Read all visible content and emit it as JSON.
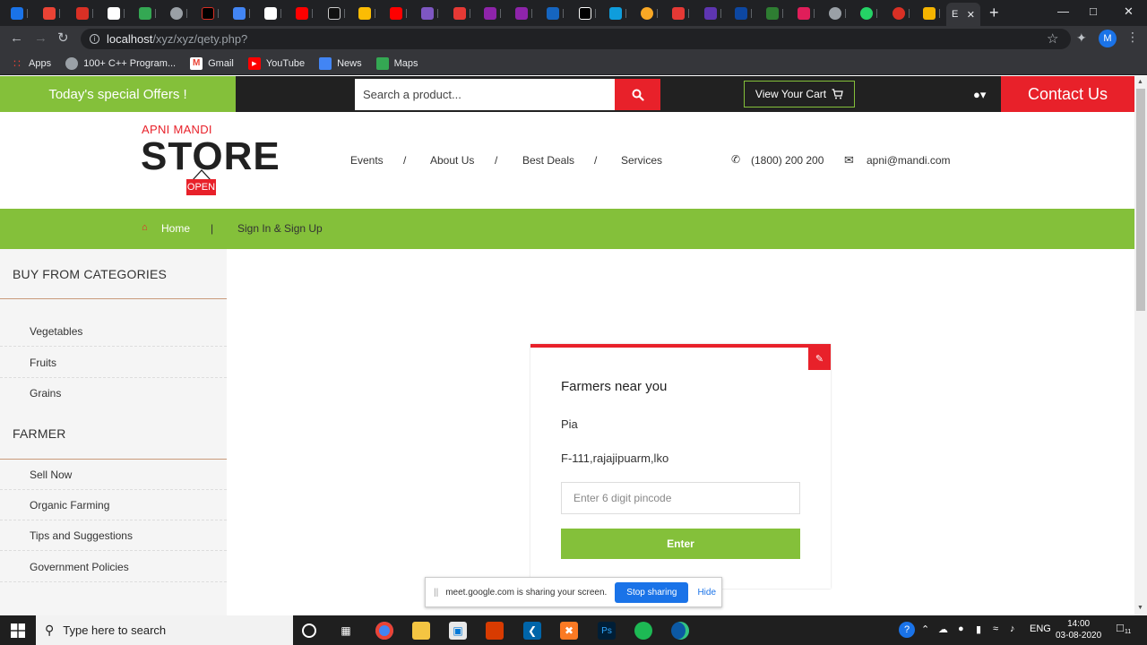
{
  "browser": {
    "url_host": "localhost",
    "url_path": "/xyz/xyz/qety.php?",
    "active_tab_label": "E",
    "profile_initial": "M",
    "bookmarks": [
      {
        "label": "Apps",
        "icon": "apps-grid-icon"
      },
      {
        "label": "100+ C++ Program...",
        "icon": "site-favicon-icon"
      },
      {
        "label": "Gmail",
        "icon": "gmail-icon"
      },
      {
        "label": "YouTube",
        "icon": "youtube-icon"
      },
      {
        "label": "News",
        "icon": "news-icon"
      },
      {
        "label": "Maps",
        "icon": "maps-icon"
      }
    ]
  },
  "topbar": {
    "offers_label": "Today's special Offers !",
    "search_placeholder": "Search a product...",
    "cart_label": "View Your Cart",
    "contact_label": "Contact Us"
  },
  "header": {
    "logo_small": "APNI MANDI",
    "logo_big": "STORE",
    "logo_sign": "OPEN",
    "nav": [
      "Events",
      "About Us",
      "Best Deals",
      "Services"
    ],
    "nav_separator": "/",
    "phone": "(1800) 200 200",
    "email": "apni@mandi.com"
  },
  "breadcrumb": {
    "home": "Home",
    "separator": "|",
    "signin": "Sign In & Sign Up"
  },
  "sidebar": {
    "categories_heading": "BUY FROM CATEGORIES",
    "categories": [
      "Vegetables",
      "Fruits",
      "Grains"
    ],
    "farmer_heading": "FARMER",
    "farmer_items": [
      "Sell Now",
      "Organic Farming",
      "Tips and Suggestions",
      "Government Policies"
    ]
  },
  "card": {
    "title": "Farmers near you",
    "name": "Pia",
    "address": "F-111,rajajipuarm,lko",
    "pincode_placeholder": "Enter 6 digit pincode",
    "button": "Enter"
  },
  "share_bar": {
    "text": "meet.google.com is sharing your screen.",
    "stop": "Stop sharing",
    "hide": "Hide"
  },
  "taskbar": {
    "search_placeholder": "Type here to search",
    "language": "ENG",
    "time": "14:00",
    "date": "03-08-2020",
    "notification_count": "11"
  },
  "colors": {
    "brand_green": "#84c03a",
    "brand_red": "#e8212a",
    "dark_bar": "#212121"
  }
}
